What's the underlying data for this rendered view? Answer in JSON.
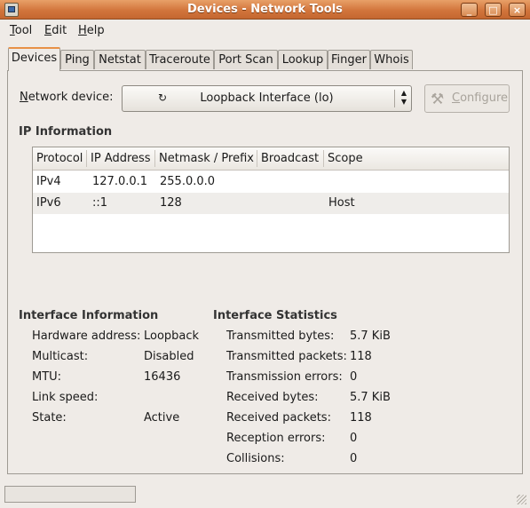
{
  "window": {
    "title": "Devices - Network Tools",
    "controls": [
      "_",
      "□",
      "×"
    ]
  },
  "menu": [
    {
      "label": "Tool",
      "mnemonic": "T",
      "rest": "ool"
    },
    {
      "label": "Edit",
      "mnemonic": "E",
      "rest": "dit"
    },
    {
      "label": "Help",
      "mnemonic": "H",
      "rest": "elp"
    }
  ],
  "tabs": [
    "Devices",
    "Ping",
    "Netstat",
    "Traceroute",
    "Port Scan",
    "Lookup",
    "Finger",
    "Whois"
  ],
  "active_tab": "Devices",
  "device": {
    "label_mnemonic": "N",
    "label_rest": "etwork device:",
    "selected": "Loopback Interface (lo)",
    "configure_mnemonic": "C",
    "configure_rest": "onfigure"
  },
  "ip_info": {
    "title": "IP Information",
    "columns": [
      "Protocol",
      "IP Address",
      "Netmask / Prefix",
      "Broadcast",
      "Scope"
    ],
    "rows": [
      [
        "IPv4",
        "127.0.0.1",
        "255.0.0.0",
        "",
        ""
      ],
      [
        "IPv6",
        "::1",
        "128",
        "",
        "Host"
      ]
    ]
  },
  "interface_info": {
    "title": "Interface Information",
    "items": [
      {
        "label": "Hardware address:",
        "value": "Loopback"
      },
      {
        "label": "Multicast:",
        "value": "Disabled"
      },
      {
        "label": "MTU:",
        "value": "16436"
      },
      {
        "label": "Link speed:",
        "value": ""
      },
      {
        "label": "State:",
        "value": "Active"
      }
    ]
  },
  "interface_stats": {
    "title": "Interface Statistics",
    "items": [
      {
        "label": "Transmitted bytes:",
        "value": "5.7 KiB"
      },
      {
        "label": "Transmitted packets:",
        "value": "118"
      },
      {
        "label": "Transmission errors:",
        "value": "0"
      },
      {
        "label": "Received bytes:",
        "value": "5.7 KiB"
      },
      {
        "label": "Received packets:",
        "value": "118"
      },
      {
        "label": "Reception errors:",
        "value": "0"
      },
      {
        "label": "Collisions:",
        "value": "0"
      }
    ]
  },
  "colors": {
    "titlebar": "#d2753c",
    "window_bg": "#efebe7",
    "active_tab_accent": "#e89146"
  }
}
